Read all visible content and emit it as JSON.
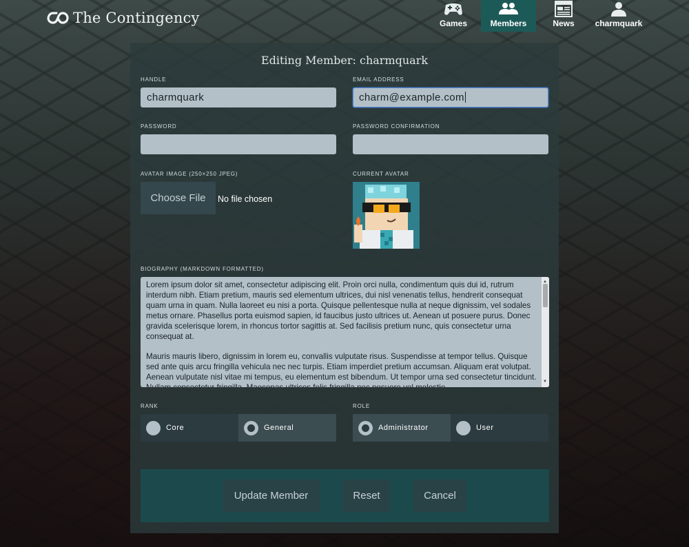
{
  "brand": {
    "name": "The Contingency"
  },
  "nav": [
    {
      "label": "Games",
      "icon": "gamepad-icon",
      "active": false
    },
    {
      "label": "Members",
      "icon": "members-icon",
      "active": true
    },
    {
      "label": "News",
      "icon": "news-icon",
      "active": false
    },
    {
      "label": "charmquark",
      "icon": "user-icon",
      "active": false
    }
  ],
  "form": {
    "title": "Editing Member: charmquark",
    "handle": {
      "label": "Handle",
      "value": "charmquark"
    },
    "email": {
      "label": "Email Address",
      "value": "charm@example.com"
    },
    "password": {
      "label": "Password",
      "value": ""
    },
    "password_confirmation": {
      "label": "Password Confirmation",
      "value": ""
    },
    "avatar_upload": {
      "label": "Avatar Image (250×250 JPEG)",
      "button": "Choose File",
      "status": "No file chosen"
    },
    "current_avatar": {
      "label": "Current Avatar"
    },
    "biography": {
      "label": "Biography (Markdown Formatted)",
      "paragraph_1": "Lorem ipsum dolor sit amet, consectetur adipiscing elit. Proin orci nulla, condimentum quis dui id, rutrum interdum nibh. Etiam pretium, mauris sed elementum ultrices, dui nisl venenatis tellus, hendrerit consequat quam urna in quam. Nulla laoreet eu nisi a porta. Quisque pellentesque nulla at neque dignissim, vel sodales metus ornare. Phasellus porta euismod sapien, id faucibus justo ultrices ut. Aenean ut posuere purus. Donec gravida scelerisque lorem, in rhoncus tortor sagittis at. Sed facilisis pretium nunc, quis consectetur urna consequat at.",
      "paragraph_2": "Mauris mauris libero, dignissim in lorem eu, convallis vulputate risus. Suspendisse at tempor tellus. Quisque sed ante quis arcu fringilla vehicula nec nec turpis. Etiam imperdiet pretium accumsan. Aliquam erat volutpat. Aenean vulputate nisl vitae mi tempus, eu elementum est bibendum. Ut tempor urna sed consectetur tincidunt. Nullam consectetur fringilla. Maecenas ultrices felis fringilla nec posuere vel molestie."
    },
    "rank": {
      "label": "Rank",
      "options": [
        "Core",
        "General"
      ],
      "selected": "General"
    },
    "role": {
      "label": "Role",
      "options": [
        "Administrator",
        "User"
      ],
      "selected": "Administrator"
    },
    "buttons": {
      "update": "Update Member",
      "reset": "Reset",
      "cancel": "Cancel"
    }
  },
  "colors": {
    "accent": "#1c5a58",
    "panel": "#2c3a3c",
    "input": "#b3c0c8",
    "focus": "#4d86d9"
  }
}
